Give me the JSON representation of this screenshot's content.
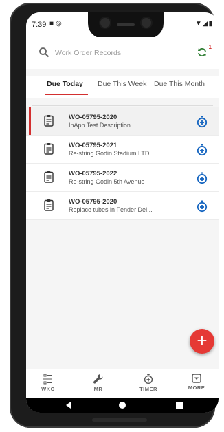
{
  "status_bar": {
    "time": "7:39"
  },
  "search": {
    "placeholder": "Work Order Records",
    "sync_badge": "1"
  },
  "tabs": [
    {
      "label": "Due Today",
      "active": true
    },
    {
      "label": "Due This Week",
      "active": false
    },
    {
      "label": "Due This Month",
      "active": false
    }
  ],
  "work_orders": [
    {
      "number": "WO-05795-2020",
      "description": "InApp Test Description",
      "selected": true
    },
    {
      "number": "WO-05795-2021",
      "description": "Re-string Godin Stadium LTD",
      "selected": false
    },
    {
      "number": "WO-05795-2022",
      "description": "Re-string Godin 5th Avenue",
      "selected": false
    },
    {
      "number": "WO-05795-2020",
      "description": "Replace tubes in Fender Del...",
      "selected": false
    }
  ],
  "fab": {
    "label": "+"
  },
  "bottom_nav": [
    {
      "label": "WKO",
      "icon": "list-icon"
    },
    {
      "label": "MR",
      "icon": "wrench-icon"
    },
    {
      "label": "TIMER",
      "icon": "stopwatch-icon"
    },
    {
      "label": "MORE",
      "icon": "more-box-icon"
    }
  ],
  "colors": {
    "accent": "#d32f2f",
    "timer": "#1565c0",
    "sync": "#2e7d32"
  }
}
